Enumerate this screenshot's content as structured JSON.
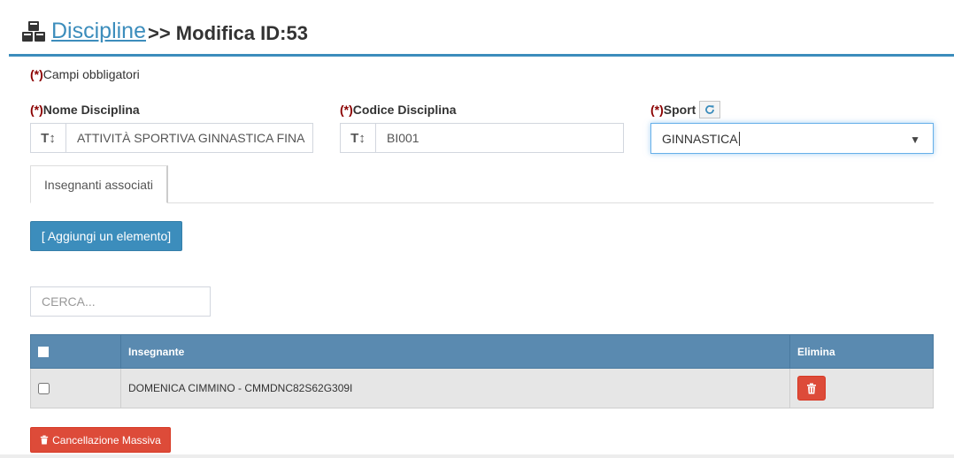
{
  "header": {
    "icon": "cubes-icon",
    "title_link": "Discipline",
    "title_rest": ">> Modifica ID:53",
    "accent_color": "#3c8dbc"
  },
  "form": {
    "required_marker": "(*)",
    "mandatory_note": "Campi obbligatori",
    "nome": {
      "label": "Nome Disciplina",
      "addon_icon": "text-height-icon",
      "addon_text": "T↕",
      "value": "ATTIVITÀ SPORTIVA GINNASTICA FINA"
    },
    "codice": {
      "label": "Codice Disciplina",
      "addon_icon": "text-height-icon",
      "addon_text": "T↕",
      "value": "BI001"
    },
    "sport": {
      "label": "Sport",
      "refresh_icon": "refresh-icon",
      "selected": "GINNASTICA",
      "arrow": "▼"
    }
  },
  "tabs": [
    {
      "label": "Insegnanti associati",
      "active": true
    }
  ],
  "add_button_label": "[ Aggiungi un elemento]",
  "search": {
    "placeholder": "CERCA..."
  },
  "table": {
    "header_color": "#5a8ab0",
    "columns": [
      "Insegnante",
      "Elimina"
    ],
    "rows": [
      {
        "insegnante": "DOMENICA CIMMINO - CMMDNC82S62G309I",
        "delete_icon": "trash-icon"
      }
    ]
  },
  "bulk_delete_label": "Cancellazione Massiva",
  "danger_color": "#dd4b39"
}
